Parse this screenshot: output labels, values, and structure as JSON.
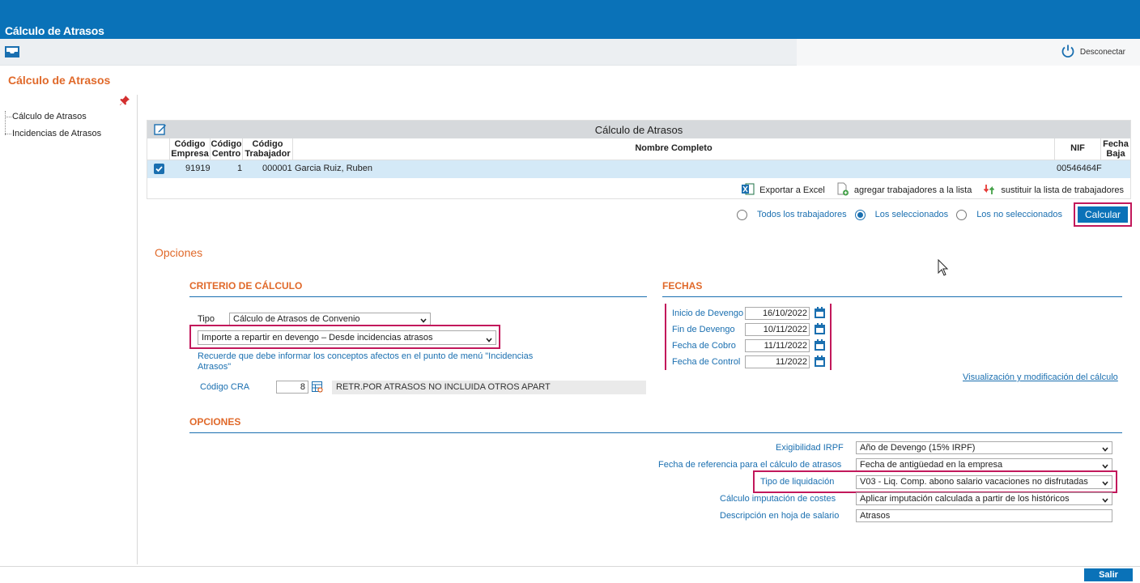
{
  "app": {
    "title": "Cálculo de Atrasos"
  },
  "toolbar": {
    "logout_label": "Desconectar"
  },
  "page": {
    "title": "Cálculo de Atrasos"
  },
  "sidebar": {
    "items": [
      {
        "label": "Cálculo de Atrasos"
      },
      {
        "label": "Incidencias de Atrasos"
      }
    ]
  },
  "grid": {
    "title": "Cálculo de Atrasos",
    "columns": [
      "Código Empresa",
      "Código Centro",
      "Código Trabajador",
      "Nombre Completo",
      "NIF",
      "Fecha Baja"
    ],
    "rows": [
      {
        "checked": true,
        "empresa": "91919",
        "centro": "1",
        "trabajador": "000001",
        "nombre": "Garcia Ruiz, Ruben",
        "nif": "00546464F",
        "baja": ""
      }
    ],
    "actions": {
      "export": "Exportar a Excel",
      "add": "agregar trabajadores a la lista",
      "replace": "sustituir la lista de trabajadores"
    }
  },
  "selection": {
    "options": [
      "Todos los trabajadores",
      "Los seleccionados",
      "Los no seleccionados"
    ],
    "selected": "Los seleccionados",
    "calcular_label": "Calcular"
  },
  "opciones": {
    "title": "Opciones",
    "criterio": {
      "header": "CRITERIO DE CÁLCULO",
      "tipo_label": "Tipo",
      "tipo_value": "Cálculo de Atrasos de Convenio",
      "modo_value": "Importe a repartir en devengo – Desde incidencias atrasos",
      "note": "Recuerde que debe informar los conceptos afectos en el punto de menú \"Incidencias Atrasos\"",
      "cra_label": "Código CRA",
      "cra_value": "8",
      "cra_desc": "RETR.POR ATRASOS NO INCLUIDA OTROS APART"
    },
    "fechas": {
      "header": "FECHAS",
      "inicio_label": "Inicio de Devengo",
      "inicio_value": "16/10/2022",
      "fin_label": "Fin de Devengo",
      "fin_value": "10/11/2022",
      "cobro_label": "Fecha de Cobro",
      "cobro_value": "11/11/2022",
      "control_label": "Fecha de Control",
      "control_value": "11/2022",
      "link": "Visualización y modificación del cálculo"
    },
    "opciones2": {
      "header": "OPCIONES",
      "irpf_label": "Exigibilidad IRPF",
      "irpf_value": "Año de Devengo (15% IRPF)",
      "ref_label": "Fecha de referencia para el cálculo de atrasos",
      "ref_value": "Fecha de antigüedad en la empresa",
      "liq_label": "Tipo de liquidación",
      "liq_value": "V03 - Liq. Comp. abono salario vacaciones no disfrutadas",
      "costes_label": "Cálculo imputación de costes",
      "costes_value": "Aplicar imputación calculada a partir de los históricos",
      "desc_label": "Descripción en hoja de salario",
      "desc_value": "Atrasos"
    }
  },
  "footer": {
    "salir_label": "Salir"
  },
  "colors": {
    "brand": "#0a72b8",
    "accent": "#e0692a",
    "highlight": "#c2185b",
    "link": "#1a6fb0",
    "row_selected": "#d4e9f7"
  }
}
